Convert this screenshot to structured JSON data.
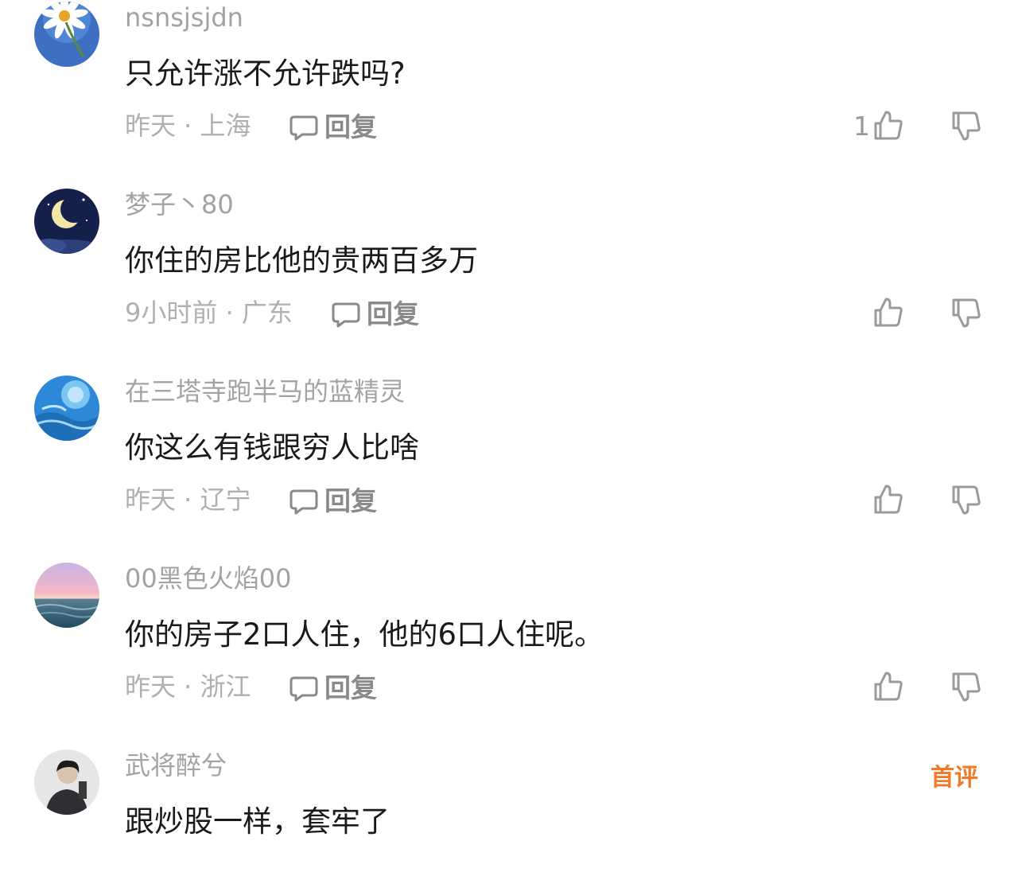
{
  "comments": [
    {
      "username": "nsnsjsjdn",
      "content": "只允许涨不允许跌吗?",
      "meta": "昨天 · 上海",
      "reply_label": "回复",
      "likes": "1",
      "avatar": "daisy-avatar"
    },
    {
      "username": "梦子丶80",
      "content": "你住的房比他的贵两百多万",
      "meta": "9小时前 · 广东",
      "reply_label": "回复",
      "likes": "",
      "avatar": "moon-avatar"
    },
    {
      "username": "在三塔寺跑半马的蓝精灵",
      "content": "你这么有钱跟穷人比啥",
      "meta": "昨天 · 辽宁",
      "reply_label": "回复",
      "likes": "",
      "avatar": "blue-swirl-avatar"
    },
    {
      "username": "00黑色火焰00",
      "content": "你的房子2口人住，他的6口人住呢。",
      "meta": "昨天 · 浙江",
      "reply_label": "回复",
      "likes": "",
      "avatar": "sunset-sea-avatar"
    },
    {
      "username": "武将醉兮",
      "content": "跟炒股一样，套牢了",
      "badge": "首评",
      "avatar": "person-avatar"
    }
  ],
  "colors": {
    "username": "#a3a3a3",
    "content": "#1a1a1a",
    "meta": "#b0b0b0",
    "badge": "#f07a2a"
  }
}
